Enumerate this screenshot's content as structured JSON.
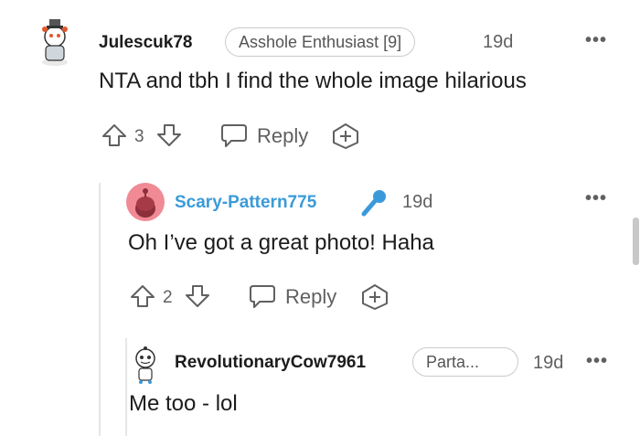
{
  "comments": [
    {
      "username": "Julescuk78",
      "flair": "Asshole Enthusiast [9]",
      "time": "19d",
      "text": "NTA and tbh I find the whole image hilarious",
      "votes": "3",
      "reply_label": "Reply",
      "more_label": "•••"
    },
    {
      "username": "Scary-Pattern775",
      "username_color": "#3a9ad9",
      "time": "19d",
      "text": "Oh I’ve got a great photo! Haha",
      "votes": "2",
      "reply_label": "Reply",
      "more_label": "•••",
      "badge_icon": "microphone-icon"
    },
    {
      "username": "RevolutionaryCow7961",
      "flair": "Parta...",
      "time": "19d",
      "text": "Me too - lol",
      "more_label": "•••"
    }
  ],
  "colors": {
    "icon_gray": "#606060",
    "thread_line": "#e4e6e8",
    "avatar_pink": "#f08a94",
    "mic_blue": "#3a9ad9"
  }
}
